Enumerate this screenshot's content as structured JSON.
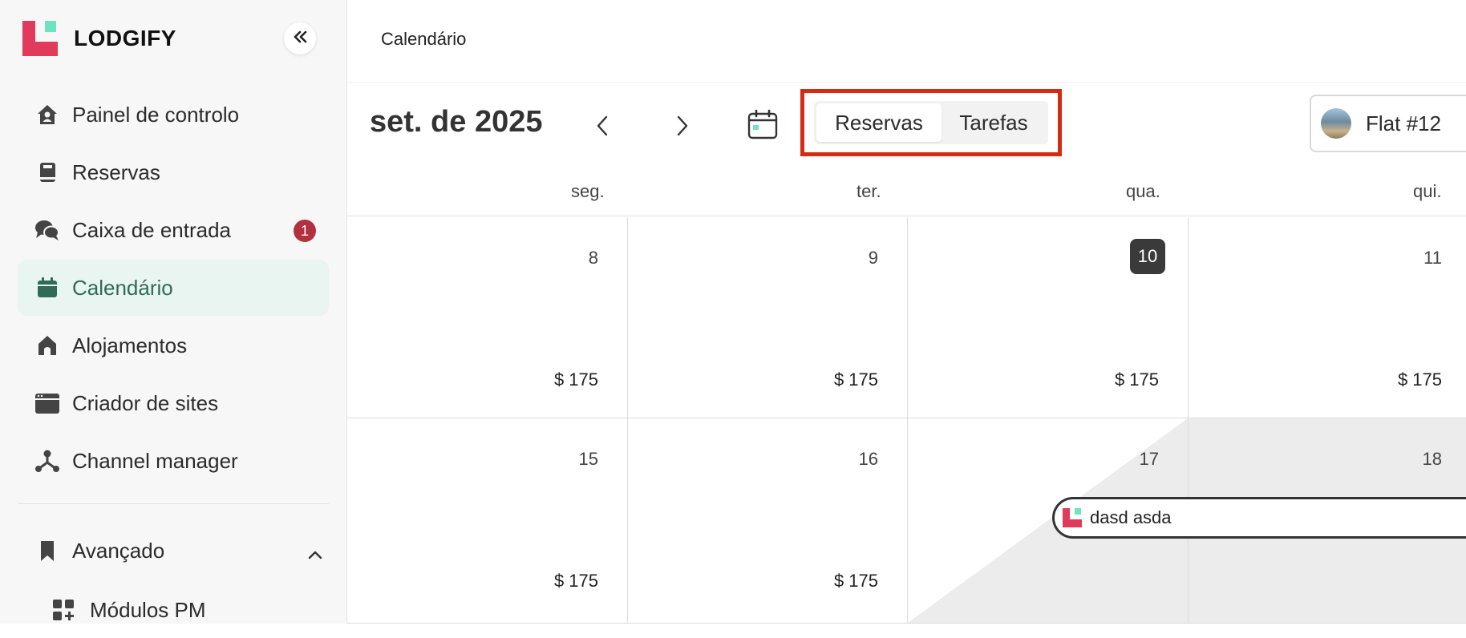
{
  "app": {
    "brand": "LODGIFY"
  },
  "sidebar": {
    "items": [
      {
        "label": "Painel de controlo",
        "icon": "home-icon"
      },
      {
        "label": "Reservas",
        "icon": "book-icon"
      },
      {
        "label": "Caixa de entrada",
        "icon": "chat-icon",
        "badge": "1"
      },
      {
        "label": "Calendário",
        "icon": "calendar-icon",
        "active": true
      },
      {
        "label": "Alojamentos",
        "icon": "house-icon"
      },
      {
        "label": "Criador de sites",
        "icon": "browser-icon"
      },
      {
        "label": "Channel manager",
        "icon": "network-icon"
      }
    ],
    "advanced": {
      "label": "Avançado",
      "icon": "bookmark-icon"
    },
    "sub_items": [
      {
        "label": "Módulos PM",
        "icon": "modules-icon"
      }
    ]
  },
  "header": {
    "breadcrumb": "Calendário"
  },
  "toolbar": {
    "month": "set. de 2025",
    "view_toggle": {
      "reservas": "Reservas",
      "tarefas": "Tarefas"
    },
    "property": "Flat #12"
  },
  "weekdays": [
    "seg.",
    "ter.",
    "qua.",
    "qui."
  ],
  "weeks": [
    {
      "days": [
        "8",
        "9",
        "10",
        "11"
      ],
      "prices": [
        "$ 175",
        "$ 175",
        "$ 175",
        "$ 175"
      ]
    },
    {
      "days": [
        "15",
        "16",
        "17",
        "18"
      ],
      "prices": [
        "$ 175",
        "$ 175",
        "",
        ""
      ]
    }
  ],
  "today": "10",
  "booking": {
    "guest": "dasd asda"
  },
  "colors": {
    "accent": "#2f6b57",
    "active_bg": "#e8f5f1",
    "highlight_border": "#d42b12",
    "badge": "#b2303f",
    "brand_pink": "#e13b5c",
    "brand_mint": "#6fe3c1"
  }
}
